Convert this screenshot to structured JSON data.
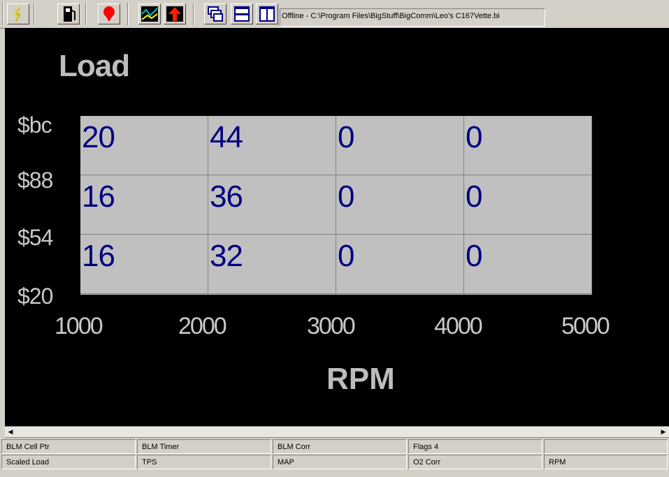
{
  "toolbar": {
    "buttons": [
      {
        "name": "lightning-icon",
        "color": "#e6d200"
      },
      {
        "name": "fuel-pump-icon",
        "color": "#000000"
      },
      {
        "name": "map-pin-icon",
        "color": "#ff0000"
      },
      {
        "name": "graph-icon",
        "color": "#008080"
      },
      {
        "name": "upload-icon",
        "color": "#ff0000"
      },
      {
        "name": "cascade-windows-icon",
        "color": "#000080"
      },
      {
        "name": "tile-horizontal-icon",
        "color": "#000080"
      },
      {
        "name": "tile-vertical-icon",
        "color": "#000080"
      }
    ],
    "path": "Offline - C:\\Program Files\\BigStuff\\BigComm\\Leo's C167Vette.bi"
  },
  "table": {
    "title": "Load",
    "x_axis_title": "RPM",
    "y_labels": [
      "$bc",
      "$88",
      "$54",
      "$20"
    ],
    "x_labels": [
      "1000",
      "2000",
      "3000",
      "4000",
      "5000"
    ],
    "rows": [
      [
        "20",
        "44",
        "0",
        "0"
      ],
      [
        "16",
        "36",
        "0",
        "0"
      ],
      [
        "16",
        "32",
        "0",
        "0"
      ]
    ]
  },
  "status": {
    "row1": [
      "BLM Cell Ptr",
      "BLM Timer",
      "BLM Corr",
      "Flags 4",
      ""
    ],
    "row2": [
      "Scaled Load",
      "TPS",
      "MAP",
      "O2 Corr",
      "RPM"
    ]
  },
  "colors": {
    "background": "#000000",
    "cell_bg": "#c0c0c0",
    "cell_text": "#000080",
    "axis_text": "#c8c8c8"
  }
}
